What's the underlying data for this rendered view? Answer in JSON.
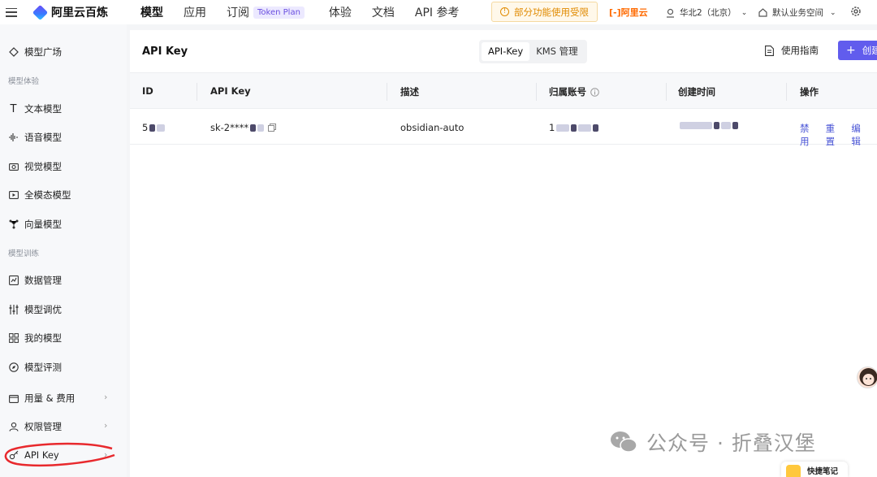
{
  "header": {
    "logo_text": "阿里云百炼",
    "nav": [
      {
        "label": "模型",
        "active": true
      },
      {
        "label": "应用",
        "active": false
      },
      {
        "label": "订阅",
        "active": false,
        "tag": "Token Plan"
      },
      {
        "label": "体验",
        "active": false
      },
      {
        "label": "文档",
        "active": false
      },
      {
        "label": "API 参考",
        "active": false
      }
    ],
    "warning": "部分功能使用受限",
    "brand": "[-]阿里云",
    "region": "华北2（北京）",
    "workspace": "默认业务空间"
  },
  "sidebar": {
    "items": [
      {
        "label": "模型广场",
        "icon": "model-square-icon"
      },
      {
        "group": "模型体验"
      },
      {
        "label": "文本模型",
        "icon": "text-icon"
      },
      {
        "label": "语音模型",
        "icon": "audio-wave-icon"
      },
      {
        "label": "视觉模型",
        "icon": "camera-icon"
      },
      {
        "label": "全模态模型",
        "icon": "omni-icon"
      },
      {
        "label": "向量模型",
        "icon": "vector-icon"
      },
      {
        "group": "模型训练"
      },
      {
        "label": "数据管理",
        "icon": "chart-icon"
      },
      {
        "label": "模型调优",
        "icon": "sliders-icon"
      },
      {
        "label": "我的模型",
        "icon": "grid-icon"
      },
      {
        "label": "模型评测",
        "icon": "compass-icon"
      },
      {
        "label": "用量 & 费用",
        "icon": "wallet-icon",
        "expandable": true
      },
      {
        "label": "权限管理",
        "icon": "user-icon",
        "expandable": true
      },
      {
        "label": "API Key",
        "icon": "key-icon",
        "expandable": true
      }
    ]
  },
  "main": {
    "title": "API Key",
    "tabs": [
      {
        "label": "API-Key",
        "active": true
      },
      {
        "label": "KMS 管理",
        "active": false
      }
    ],
    "guide": "使用指南",
    "create_button": "创建",
    "columns": [
      "ID",
      "API Key",
      "描述",
      "归属账号",
      "创建时间",
      "操作"
    ],
    "rows": [
      {
        "id": "5",
        "api_key": "sk-2****",
        "description": "obsidian-auto",
        "account": "1",
        "created": "",
        "actions": [
          "禁用",
          "重置",
          "编辑"
        ]
      }
    ]
  },
  "watermark": "公众号 · 折叠汉堡",
  "quick_note": "快捷笔记",
  "colors": {
    "accent": "#615ced",
    "warning": "#e08a00",
    "brand_orange": "#ff6a00",
    "link": "#4a55d6",
    "annotation_red": "#e8292d"
  }
}
